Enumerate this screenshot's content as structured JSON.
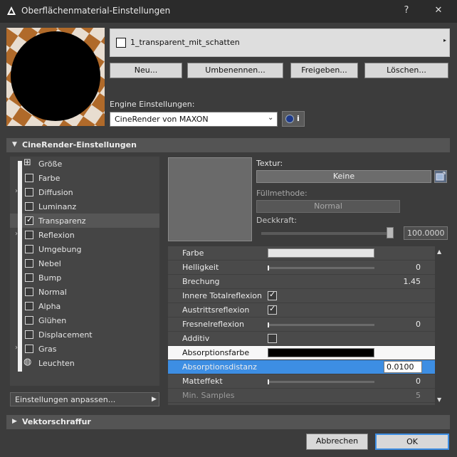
{
  "window": {
    "title": "Oberflächenmaterial-Einstellungen",
    "help_label": "?",
    "close_label": "✕"
  },
  "material": {
    "name": "1_transparent_mit_schatten",
    "arrow": "▸"
  },
  "actions": {
    "new": "Neu...",
    "rename": "Umbenennen...",
    "share": "Freigeben...",
    "delete": "Löschen..."
  },
  "engine": {
    "label": "Engine Einstellungen:",
    "value": "CineRender von MAXON",
    "arrow": "⌄",
    "info_label": "i"
  },
  "sections": {
    "cinerender": {
      "label": "CineRender-Einstellungen",
      "arrow": "▼"
    },
    "vector_hatching": {
      "label": "Vektorschraffur",
      "arrow": "▶"
    }
  },
  "channels": [
    {
      "label": "Größe",
      "glyph": "⊞",
      "type": "size"
    },
    {
      "label": "Farbe",
      "checked": false
    },
    {
      "label": "Diffusion",
      "checked": false,
      "expander": "›"
    },
    {
      "label": "Luminanz",
      "checked": false
    },
    {
      "label": "Transparenz",
      "checked": true,
      "selected": true
    },
    {
      "label": "Reflexion",
      "checked": false,
      "expander": "›"
    },
    {
      "label": "Umgebung",
      "checked": false
    },
    {
      "label": "Nebel",
      "checked": false
    },
    {
      "label": "Bump",
      "checked": false
    },
    {
      "label": "Normal",
      "checked": false
    },
    {
      "label": "Alpha",
      "checked": false
    },
    {
      "label": "Glühen",
      "checked": false
    },
    {
      "label": "Displacement",
      "checked": false
    },
    {
      "label": "Gras",
      "checked": false,
      "expander": "›"
    },
    {
      "label": "Leuchten",
      "glyph": "◍",
      "type": "light"
    }
  ],
  "customize": {
    "label": "Einstellungen anpassen...",
    "arrow": "▶"
  },
  "texture": {
    "label": "Textur:",
    "value": "Keine",
    "fill_method_label": "Füllmethode:",
    "fill_method_value": "Normal",
    "opacity_label": "Deckkraft:",
    "opacity_value": "100.0000",
    "opacity_level": 1.0
  },
  "properties": [
    {
      "label": "Farbe",
      "kind": "swatch",
      "color": "#e6e6e6"
    },
    {
      "label": "Helligkeit",
      "kind": "slider",
      "value": "0"
    },
    {
      "label": "Brechung",
      "kind": "number",
      "value": "1.45"
    },
    {
      "label": "Innere Totalreflexion",
      "kind": "check",
      "checked": true
    },
    {
      "label": "Austrittsreflexion",
      "kind": "check",
      "checked": true
    },
    {
      "label": "Fresnelreflexion",
      "kind": "slider",
      "value": "0"
    },
    {
      "label": "Additiv",
      "kind": "check",
      "checked": false
    },
    {
      "label": "Absorptionsfarbe",
      "kind": "swatch",
      "color": "#000000",
      "highlight": "white"
    },
    {
      "label": "Absorptionsdistanz",
      "kind": "edit",
      "value": "0.0100",
      "highlight": "selected"
    },
    {
      "label": "Matteffekt",
      "kind": "slider",
      "value": "0"
    },
    {
      "label": "Min. Samples",
      "kind": "number",
      "value": "5",
      "dim": true
    }
  ],
  "scroll": {
    "up": "▲",
    "down": "▼"
  },
  "footer": {
    "cancel": "Abbrechen",
    "ok": "OK"
  },
  "colors": {
    "accent": "#3d8ee3",
    "window_bg": "#3c3c3c",
    "titlebar_bg": "#2b2b2b"
  }
}
